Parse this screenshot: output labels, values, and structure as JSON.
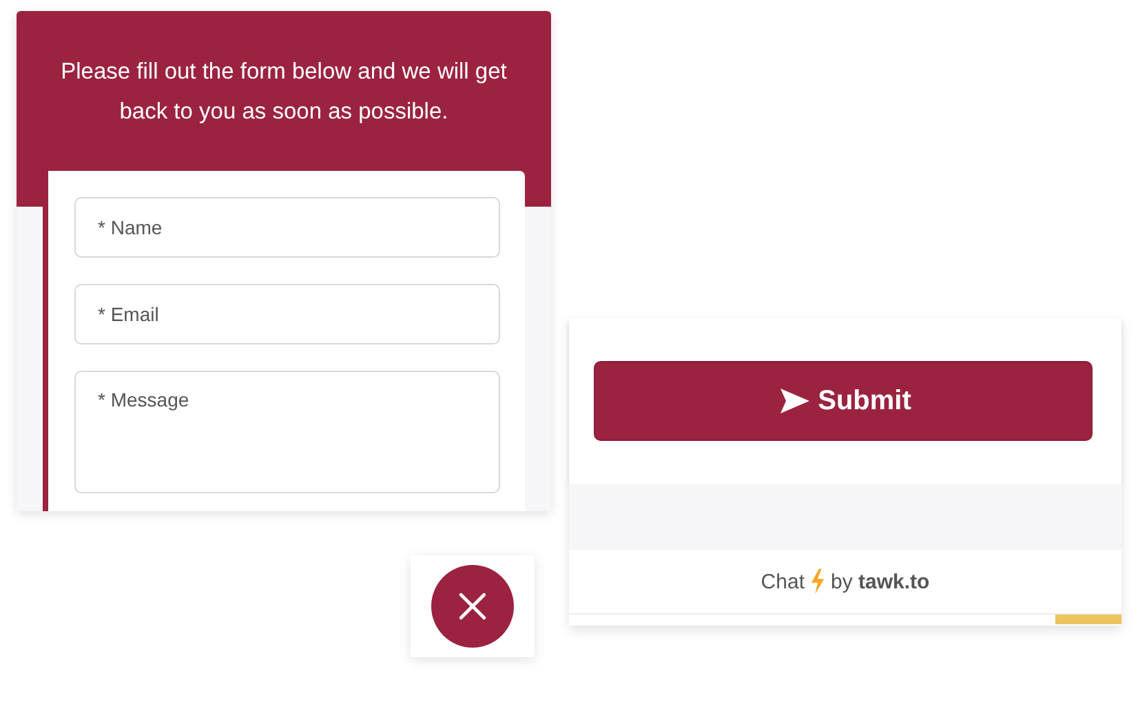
{
  "form_panel": {
    "intro": "Please fill out the form below and we will get back to you as soon as possible.",
    "fields": [
      {
        "kind": "input",
        "placeholder": "* Name"
      },
      {
        "kind": "input",
        "placeholder": "* Email"
      },
      {
        "kind": "textarea",
        "placeholder": "* Message"
      }
    ]
  },
  "submit_panel": {
    "button": "Submit",
    "footer": {
      "left": "Chat",
      "right": "by **tawk.to**"
    }
  },
  "close_button": {
    "kind": "close"
  }
}
